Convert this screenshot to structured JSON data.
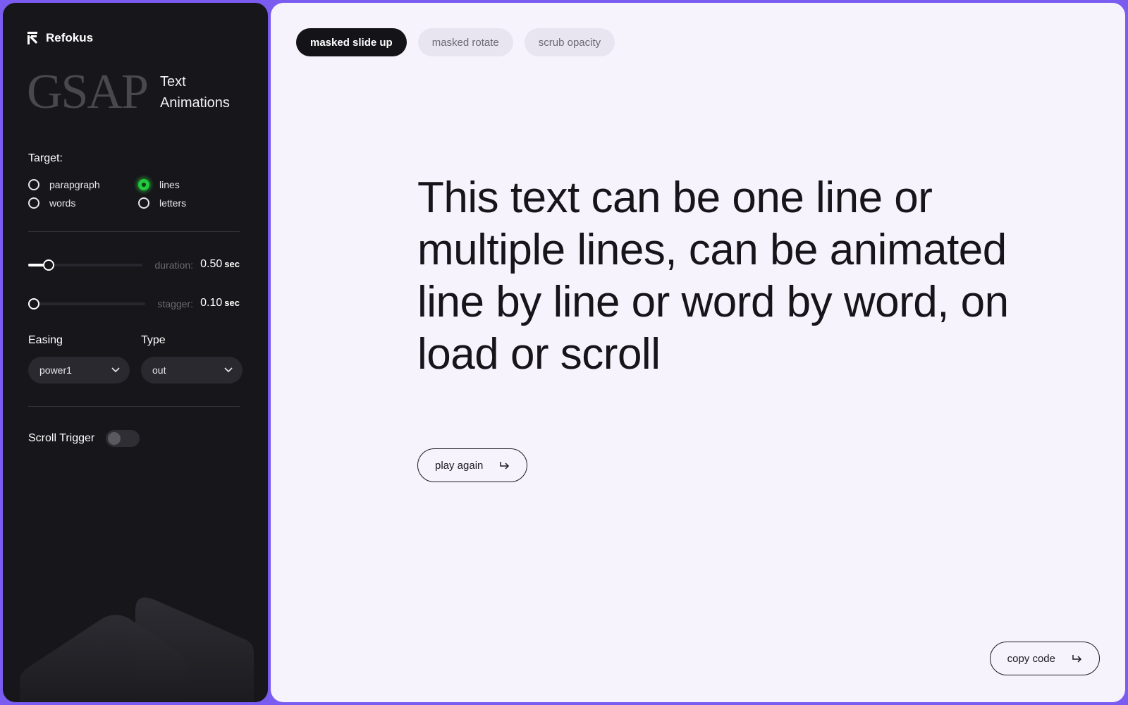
{
  "brand": {
    "name": "Refokus",
    "icon": "refokus-logo-icon"
  },
  "hero": {
    "logo_word": "GSAP",
    "subtitle_line1": "Text",
    "subtitle_line2": "Animations"
  },
  "target": {
    "heading": "Target:",
    "options": [
      {
        "label": "parapgraph",
        "selected": false
      },
      {
        "label": "lines",
        "selected": true
      },
      {
        "label": "words",
        "selected": false
      },
      {
        "label": "letters",
        "selected": false
      }
    ]
  },
  "duration": {
    "label": "duration:",
    "value": "0.50",
    "unit": "sec",
    "level": 0.13
  },
  "stagger": {
    "label": "stagger:",
    "value": "0.10",
    "unit": "sec",
    "level": 0.0
  },
  "easing": {
    "label": "Easing",
    "value": "power1"
  },
  "type": {
    "label": "Type",
    "value": "out"
  },
  "scroll_trigger": {
    "label": "Scroll Trigger",
    "enabled": false
  },
  "tabs": [
    {
      "label": "masked slide up",
      "active": true
    },
    {
      "label": "masked rotate",
      "active": false
    },
    {
      "label": "scrub opacity",
      "active": false
    }
  ],
  "headline": "This text can be one line or multiple lines, can be animated line by line or word by word, on load or scroll",
  "play_button": {
    "label": "play again",
    "icon": "arrow-right-icon"
  },
  "copy_button": {
    "label": "copy code",
    "icon": "arrow-right-icon"
  },
  "colors": {
    "accent_frame": "#7b5cf0",
    "sidebar_bg": "#17161a",
    "main_bg": "#f7f3fd",
    "radio_active": "#22c93a"
  }
}
